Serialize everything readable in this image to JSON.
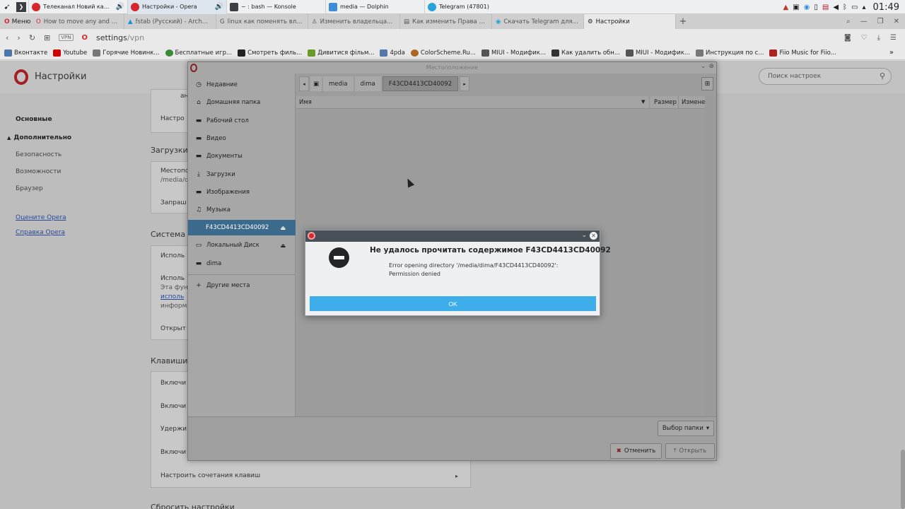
{
  "taskbar": {
    "tasks": [
      {
        "label": "Телеканал Новий канал Н...",
        "icon_color": "#d5272d",
        "sound": true
      },
      {
        "label": "Настройки - Opera",
        "icon_color": "#d5272d",
        "sound": true
      },
      {
        "label": "~ : bash — Konsole",
        "icon_color": "#3b3f44",
        "sound": false
      },
      {
        "label": "media — Dolphin",
        "icon_color": "#3d8ed8",
        "sound": false
      },
      {
        "label": "Telegram (47801)",
        "icon_color": "#2aa3dd",
        "sound": false
      }
    ],
    "clock": "01:49"
  },
  "browser": {
    "menu_label": "Меню",
    "tabs": [
      {
        "label": "How to move any and a...",
        "icon": "opera"
      },
      {
        "label": "fstab (Русский) - ArchW...",
        "icon": "arch"
      },
      {
        "label": "linux как поменять вл...",
        "icon": "google"
      },
      {
        "label": "Изменить владельца...",
        "icon": "user"
      },
      {
        "label": "Как изменить Права Д...",
        "icon": "page"
      },
      {
        "label": "Скачать Telegram для...",
        "icon": "telegram"
      },
      {
        "label": "Настройки",
        "icon": "gear",
        "active": true
      }
    ],
    "vpn_label": "VPN",
    "url_host": "settings",
    "url_path": "/vpn",
    "bookmarks": [
      {
        "label": "Вконтакте",
        "color": "#4a76a8"
      },
      {
        "label": "Youtube",
        "color": "#cc0000"
      },
      {
        "label": "Горячие Новинк...",
        "color": "#777"
      },
      {
        "label": "Бесплатные игр...",
        "color": "#3a8a3a"
      },
      {
        "label": "Смотреть филь...",
        "color": "#222"
      },
      {
        "label": "Дивитися фільм...",
        "color": "#6a9a2a"
      },
      {
        "label": "4pda",
        "color": "#5577aa"
      },
      {
        "label": "ColorScheme.Ru...",
        "color": "#aa6622"
      },
      {
        "label": "MIUI - Модифик...",
        "color": "#555"
      },
      {
        "label": "Как удалить обн...",
        "color": "#333"
      },
      {
        "label": "MIUI - Модифик...",
        "color": "#555"
      },
      {
        "label": "Инструкция по с...",
        "color": "#777"
      },
      {
        "label": "Fiio Music for Fiio...",
        "color": "#aa2222"
      }
    ]
  },
  "settings": {
    "title": "Настройки",
    "search_placeholder": "Поиск настроек",
    "nav": [
      "Основные",
      "Дополнительно",
      "Безопасность",
      "Возможности",
      "Браузер"
    ],
    "links": [
      "Оцените Opera",
      "Справка Opera"
    ],
    "sections": {
      "downloads": "Загрузки",
      "system": "Система",
      "shortcuts": "Клавиши",
      "reset": "Сбросить настройки"
    },
    "rows": {
      "r_an": "ан",
      "r_nastroi": "Настро",
      "r_mesto": "Местопо",
      "r_path": "/media/d",
      "r_zaprash": "Запраш",
      "r_ispol1": "Исполь",
      "r_ispol2": "Исполь",
      "r_eta": "Эта фун",
      "r_ispol_link": "исполь",
      "r_inform": "информа",
      "r_otkryt": "Открыт",
      "r_vkl1": "Включи",
      "r_vkl2": "Включи",
      "r_uderzh": "Удержи",
      "r_vkl3": "Включи",
      "r_shortcuts": "Настроить сочетания клавиш"
    }
  },
  "file_dialog": {
    "title": "Местоположение",
    "places": [
      {
        "label": "Недавние",
        "icon": "clock"
      },
      {
        "label": "Домашняя папка",
        "icon": "home"
      },
      {
        "label": "Рабочий стол",
        "icon": "folder"
      },
      {
        "label": "Видео",
        "icon": "folder"
      },
      {
        "label": "Документы",
        "icon": "folder"
      },
      {
        "label": "Загрузки",
        "icon": "download"
      },
      {
        "label": "Изображения",
        "icon": "folder"
      },
      {
        "label": "Музыка",
        "icon": "music"
      },
      {
        "label": "F43CD4413CD40092",
        "icon": "drive",
        "selected": true,
        "eject": true
      },
      {
        "label": "Локальный Диск",
        "icon": "drive",
        "eject": true
      },
      {
        "label": "dima",
        "icon": "folder"
      },
      {
        "label": "Другие места",
        "icon": "plus"
      }
    ],
    "crumbs": [
      "media",
      "dima",
      "F43CD4413CD40092"
    ],
    "columns": {
      "name": "Имя",
      "size": "Размер",
      "modified": "Изменен"
    },
    "filter_label": "Выбор папки",
    "cancel_label": "Отменить",
    "open_label": "Открыть"
  },
  "error_dialog": {
    "heading": "Не удалось прочитать содержимое F43CD4413CD40092",
    "message": "Error opening directory '/media/dima/F43CD4413CD40092': Permission denied",
    "ok_label": "OK"
  }
}
